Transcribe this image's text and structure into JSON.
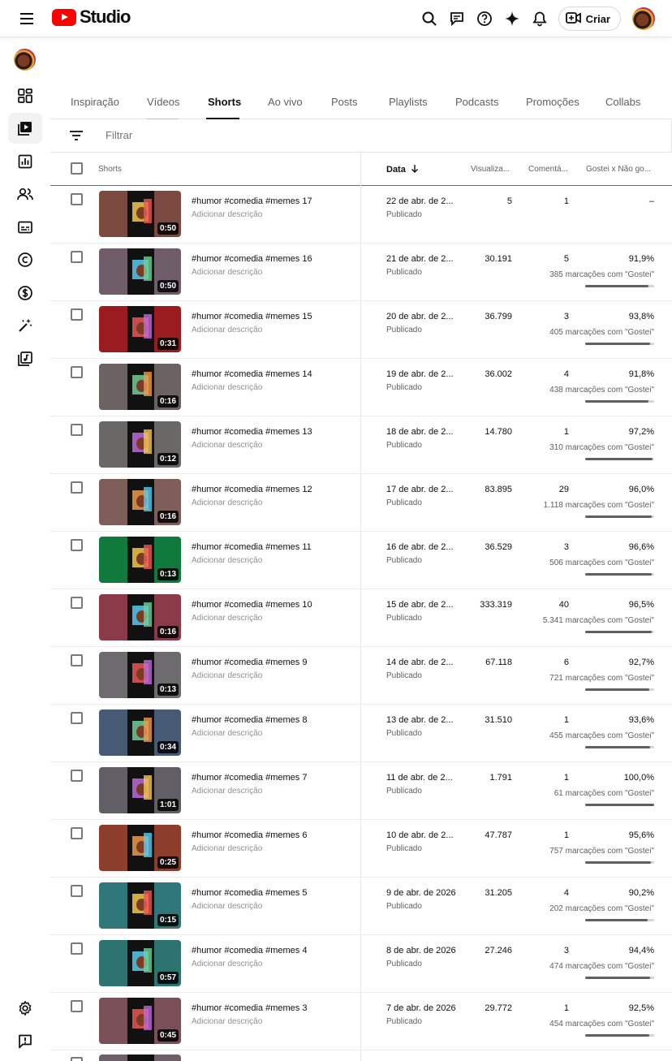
{
  "app": {
    "logo_text": "Studio",
    "create_label": "Criar",
    "icons": [
      "menu-icon",
      "search-icon",
      "feedback-icon",
      "help-icon",
      "sparkle-icon",
      "notifications-icon",
      "create-video-icon"
    ]
  },
  "sidebar": {
    "items": [
      {
        "name": "dashboard",
        "icon": "dashboard-icon"
      },
      {
        "name": "content",
        "icon": "content-icon",
        "active": true
      },
      {
        "name": "analytics",
        "icon": "analytics-icon"
      },
      {
        "name": "community",
        "icon": "community-icon"
      },
      {
        "name": "subtitles",
        "icon": "subtitles-icon"
      },
      {
        "name": "copyright",
        "icon": "copyright-icon"
      },
      {
        "name": "earn",
        "icon": "earn-icon"
      },
      {
        "name": "customization",
        "icon": "magic-wand-icon"
      },
      {
        "name": "audio-library",
        "icon": "audio-library-icon"
      }
    ],
    "bottom": [
      {
        "name": "settings",
        "icon": "settings-icon"
      },
      {
        "name": "feedback",
        "icon": "send-feedback-icon"
      }
    ]
  },
  "tabs": [
    {
      "label": "Inspiração"
    },
    {
      "label": "Vídeos"
    },
    {
      "label": "Shorts",
      "active": true
    },
    {
      "label": "Ao vivo"
    },
    {
      "label": "Posts"
    },
    {
      "label": "Playlists"
    },
    {
      "label": "Podcasts"
    },
    {
      "label": "Promoções"
    },
    {
      "label": "Collabs"
    }
  ],
  "filter": {
    "placeholder": "Filtrar"
  },
  "table": {
    "headers": {
      "content": "Shorts",
      "date": "Data",
      "views": "Visualiza...",
      "comments": "Comentá...",
      "ratio": "Gostei x Não go..."
    },
    "rows": [
      {
        "title": "#humor #comedia #memes 17",
        "description": "Adicionar descrição",
        "duration": "0:50",
        "date": "22 de abr. de 2...",
        "status": "Publicado",
        "views": "5",
        "comments": "1",
        "ratio": "–",
        "likes": "",
        "ratio_fraction": null,
        "thumb_color": "#7b4a3e"
      },
      {
        "title": "#humor #comedia #memes 16",
        "description": "Adicionar descrição",
        "duration": "0:50",
        "date": "21 de abr. de 2...",
        "status": "Publicado",
        "views": "30.191",
        "comments": "5",
        "ratio": "91,9%",
        "likes": "385 marcações com \"Gostei\"",
        "ratio_fraction": 0.919,
        "thumb_color": "#6f5d6a"
      },
      {
        "title": "#humor #comedia #memes 15",
        "description": "Adicionar descrição",
        "duration": "0:31",
        "date": "20 de abr. de 2...",
        "status": "Publicado",
        "views": "36.799",
        "comments": "3",
        "ratio": "93,8%",
        "likes": "405 marcações com \"Gostei\"",
        "ratio_fraction": 0.938,
        "thumb_color": "#9a1c20"
      },
      {
        "title": "#humor #comedia #memes 14",
        "description": "Adicionar descrição",
        "duration": "0:16",
        "date": "19 de abr. de 2...",
        "status": "Publicado",
        "views": "36.002",
        "comments": "4",
        "ratio": "91,8%",
        "likes": "438 marcações com \"Gostei\"",
        "ratio_fraction": 0.918,
        "thumb_color": "#6b6261"
      },
      {
        "title": "#humor #comedia #memes 13",
        "description": "Adicionar descrição",
        "duration": "0:12",
        "date": "18 de abr. de 2...",
        "status": "Publicado",
        "views": "14.780",
        "comments": "1",
        "ratio": "97,2%",
        "likes": "310 marcações com \"Gostei\"",
        "ratio_fraction": 0.972,
        "thumb_color": "#696866"
      },
      {
        "title": "#humor #comedia #memes 12",
        "description": "Adicionar descrição",
        "duration": "0:16",
        "date": "17 de abr. de 2...",
        "status": "Publicado",
        "views": "83.895",
        "comments": "29",
        "ratio": "96,0%",
        "likes": "1.118 marcações com \"Gostei\"",
        "ratio_fraction": 0.96,
        "thumb_color": "#7d5e58"
      },
      {
        "title": "#humor #comedia #memes 11",
        "description": "Adicionar descrição",
        "duration": "0:13",
        "date": "16 de abr. de 2...",
        "status": "Publicado",
        "views": "36.529",
        "comments": "3",
        "ratio": "96,6%",
        "likes": "506 marcações com \"Gostei\"",
        "ratio_fraction": 0.966,
        "thumb_color": "#0f7a3c"
      },
      {
        "title": "#humor #comedia #memes 10",
        "description": "Adicionar descrição",
        "duration": "0:16",
        "date": "15 de abr. de 2...",
        "status": "Publicado",
        "views": "333.319",
        "comments": "40",
        "ratio": "96,5%",
        "likes": "5.341 marcações com \"Gostei\"",
        "ratio_fraction": 0.965,
        "thumb_color": "#8a3a48"
      },
      {
        "title": "#humor #comedia #memes 9",
        "description": "Adicionar descrição",
        "duration": "0:13",
        "date": "14 de abr. de 2...",
        "status": "Publicado",
        "views": "67.118",
        "comments": "6",
        "ratio": "92,7%",
        "likes": "721 marcações com \"Gostei\"",
        "ratio_fraction": 0.927,
        "thumb_color": "#6e6b6e"
      },
      {
        "title": "#humor #comedia #memes 8",
        "description": "Adicionar descrição",
        "duration": "0:34",
        "date": "13 de abr. de 2...",
        "status": "Publicado",
        "views": "31.510",
        "comments": "1",
        "ratio": "93,6%",
        "likes": "455 marcações com \"Gostei\"",
        "ratio_fraction": 0.936,
        "thumb_color": "#465a73"
      },
      {
        "title": "#humor #comedia #memes 7",
        "description": "Adicionar descrição",
        "duration": "1:01",
        "date": "11 de abr. de 2...",
        "status": "Publicado",
        "views": "1.791",
        "comments": "1",
        "ratio": "100,0%",
        "likes": "61 marcações com \"Gostei\"",
        "ratio_fraction": 1.0,
        "thumb_color": "#625e66"
      },
      {
        "title": "#humor #comedia #memes 6",
        "description": "Adicionar descrição",
        "duration": "0:25",
        "date": "10 de abr. de 2...",
        "status": "Publicado",
        "views": "47.787",
        "comments": "1",
        "ratio": "95,6%",
        "likes": "757 marcações com \"Gostei\"",
        "ratio_fraction": 0.956,
        "thumb_color": "#8c3d2b"
      },
      {
        "title": "#humor #comedia #memes 5",
        "description": "Adicionar descrição",
        "duration": "0:15",
        "date": "9 de abr. de 2026",
        "status": "Publicado",
        "views": "31.205",
        "comments": "4",
        "ratio": "90,2%",
        "likes": "202 marcações com \"Gostei\"",
        "ratio_fraction": 0.902,
        "thumb_color": "#2f7778"
      },
      {
        "title": "#humor #comedia #memes 4",
        "description": "Adicionar descrição",
        "duration": "0:57",
        "date": "8 de abr. de 2026",
        "status": "Publicado",
        "views": "27.246",
        "comments": "3",
        "ratio": "94,4%",
        "likes": "474 marcações com \"Gostei\"",
        "ratio_fraction": 0.944,
        "thumb_color": "#2d7370"
      },
      {
        "title": "#humor #comedia #memes 3",
        "description": "Adicionar descrição",
        "duration": "0:45",
        "date": "7 de abr. de 2026",
        "status": "Publicado",
        "views": "29.772",
        "comments": "1",
        "ratio": "92,5%",
        "likes": "454 marcações com \"Gostei\"",
        "ratio_fraction": 0.925,
        "thumb_color": "#7a4f57"
      }
    ]
  }
}
